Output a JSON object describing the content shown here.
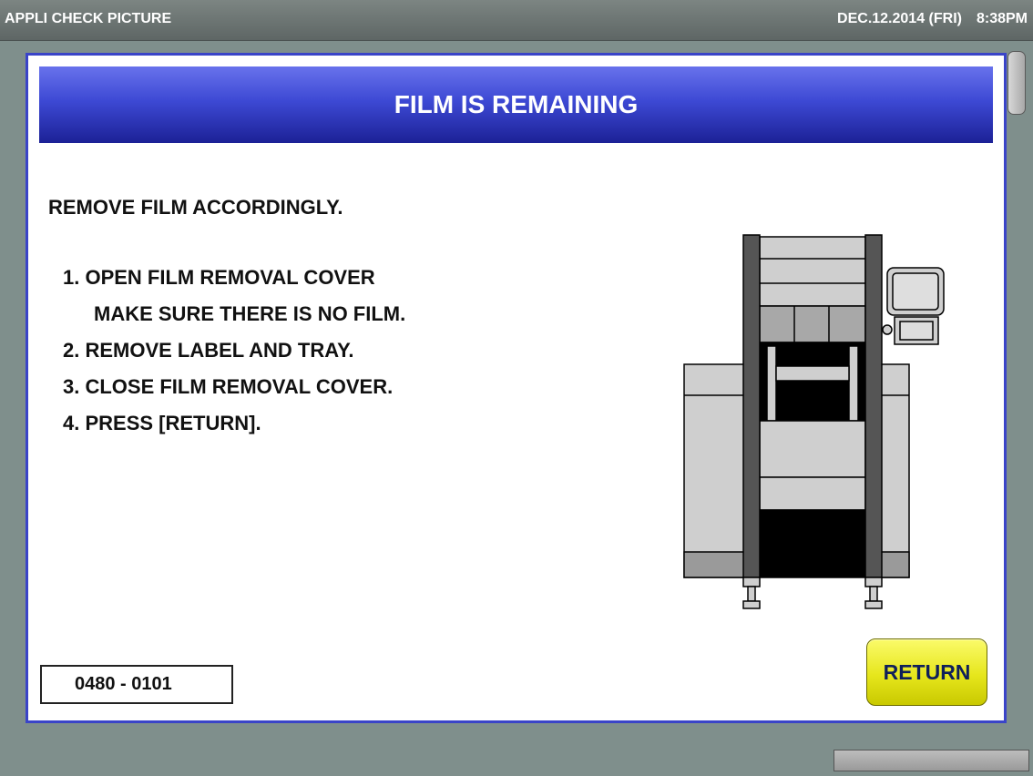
{
  "topbar": {
    "title": "APPLI CHECK PICTURE",
    "date": "DEC.12.2014 (FRI)",
    "time": "8:38PM"
  },
  "dialog": {
    "header_title": "FILM IS REMAINING",
    "intro": "REMOVE FILM ACCORDINGLY.",
    "steps": [
      {
        "line1": "1. OPEN FILM REMOVAL COVER",
        "line2": "MAKE SURE THERE IS NO FILM."
      },
      {
        "line1": "2. REMOVE LABEL AND TRAY."
      },
      {
        "line1": "3. CLOSE FILM REMOVAL COVER."
      },
      {
        "line1": "4. PRESS [RETURN]."
      }
    ],
    "code": "0480 - 0101",
    "return_label": "RETURN"
  },
  "icons": {
    "illustration": "packaging-machine-icon"
  },
  "colors": {
    "header_blue": "#3d49d4",
    "return_yellow": "#e6e61c",
    "dialog_border": "#3a44c8",
    "background": "#7f8f8c"
  }
}
